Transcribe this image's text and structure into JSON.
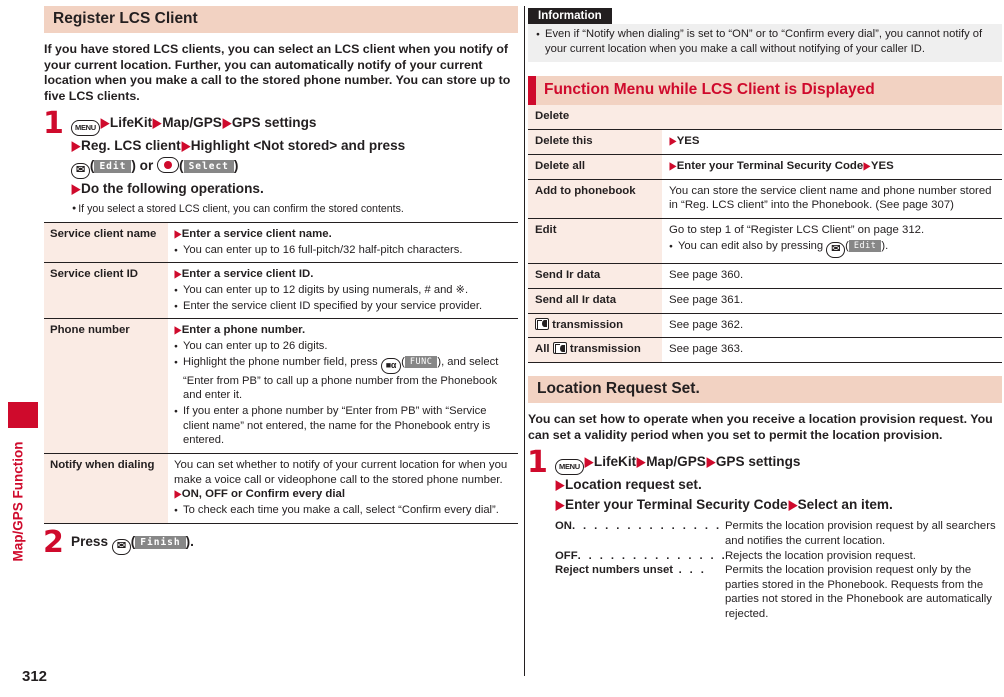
{
  "page": {
    "number": "312",
    "side_tab_label": "Map/GPS Function",
    "accent_red": "#cf0a2c",
    "header_bg": "#f2d2c2",
    "table_label_bg": "#faebe4",
    "info_bg": "#efefef"
  },
  "left": {
    "section_title": "Register LCS Client",
    "intro": "If you have stored LCS clients, you can select an LCS client when you notify of your current location. Further, you can automatically notify of your current location when you make a call to the stored phone number. You can store up to five LCS clients.",
    "step1": {
      "number": "1",
      "menu_key": "MENU",
      "line1_a": "LifeKit",
      "line1_b": "Map/GPS",
      "line1_c": "GPS settings",
      "line2_a": "Reg. LCS client",
      "line2_b": "Highlight <Not stored> and press",
      "line3_softkey_edit": "Edit",
      "line3_or": " or ",
      "line3_softkey_select": "Select",
      "line4": "Do the following operations.",
      "note": "If you select a stored LCS client, you can confirm the stored contents."
    },
    "table": [
      {
        "label": "Service client name",
        "action": "Enter a service client name.",
        "bullets": [
          "You can enter up to 16 full-pitch/32 half-pitch characters."
        ]
      },
      {
        "label": "Service client ID",
        "action": "Enter a service client ID.",
        "bullets": [
          "You can enter up to 12 digits by using numerals, # and ※.",
          "Enter the service client ID specified by your service provider."
        ]
      },
      {
        "label": "Phone number",
        "action": "Enter a phone number.",
        "bullets": [
          "You can enter up to 26 digits.",
          "Highlight the phone number field, press __IA__(__FUNC__), and select “Enter from PB” to call up a phone number from the Phonebook and enter it.",
          "If you enter a phone number by “Enter from PB” with “Service client name” not entered, the name for the Phonebook entry is entered."
        ],
        "func_softkey": "FUNC"
      },
      {
        "label": "Notify when dialing",
        "text": "You can set whether to notify of your current location for when you make a voice call or videophone call to the stored phone number.",
        "action": "ON, OFF or Confirm every dial",
        "bullets": [
          "To check each time you make a call, select “Confirm every dial”."
        ]
      }
    ],
    "step2": {
      "number": "2",
      "press_label": "Press",
      "softkey_finish": "Finish"
    }
  },
  "right": {
    "information": {
      "tag": "Information",
      "items": [
        "Even if “Notify when dialing” is set to “ON” or to “Confirm every dial”, you cannot notify of your current location when you make a call without notifying of your caller ID."
      ]
    },
    "function_menu": {
      "title": "Function Menu while LCS Client is Displayed",
      "group": {
        "label": "Delete",
        "rows": [
          {
            "label": "Delete this",
            "value": "YES"
          },
          {
            "label": "Delete all",
            "value_a": "Enter your Terminal Security Code",
            "value_b": "YES"
          }
        ]
      },
      "rows": [
        {
          "label": "Add to phonebook",
          "value": "You can store the service client name and phone number stored in “Reg. LCS client” into the Phonebook. (See page 307)"
        },
        {
          "label": "Edit",
          "value": "Go to step 1 of “Register LCS Client” on page 312.",
          "bullet": "You can edit also by pressing",
          "bullet_softkey": "Edit",
          "bullet_tail": ")."
        },
        {
          "label": "Send Ir data",
          "value": "See page 360."
        },
        {
          "label": "Send all Ir data",
          "value": "See page 361."
        },
        {
          "label_icon": "ic-transmission-icon",
          "label": "transmission",
          "value": "See page 362."
        },
        {
          "label_prefix": "All",
          "label_icon": "ic-transmission-icon",
          "label": "transmission",
          "value": "See page 363."
        }
      ]
    },
    "location_request": {
      "section_title": "Location Request Set.",
      "intro": "You can set how to operate when you receive a location provision request. You can set a validity period when you set to permit the location provision.",
      "step1": {
        "number": "1",
        "menu_key": "MENU",
        "line1_a": "LifeKit",
        "line1_b": "Map/GPS",
        "line1_c": "GPS settings",
        "line2": "Location request set.",
        "line3_a": "Enter your Terminal Security Code",
        "line3_b": "Select an item."
      },
      "options": [
        {
          "term": "ON",
          "dots": ". . . . . . . . . . . . . . . . . .",
          "desc": "Permits the location provision request by all searchers and notifies the current location."
        },
        {
          "term": "OFF",
          "dots": ". . . . . . . . . . . . . . . .",
          "desc": "Rejects the location provision request."
        },
        {
          "term": "Reject numbers unset",
          "dots": " . . .",
          "desc": "Permits the location provision request only by the parties stored in the Phonebook. Requests from the parties not stored in the Phonebook are automatically rejected."
        }
      ]
    }
  }
}
